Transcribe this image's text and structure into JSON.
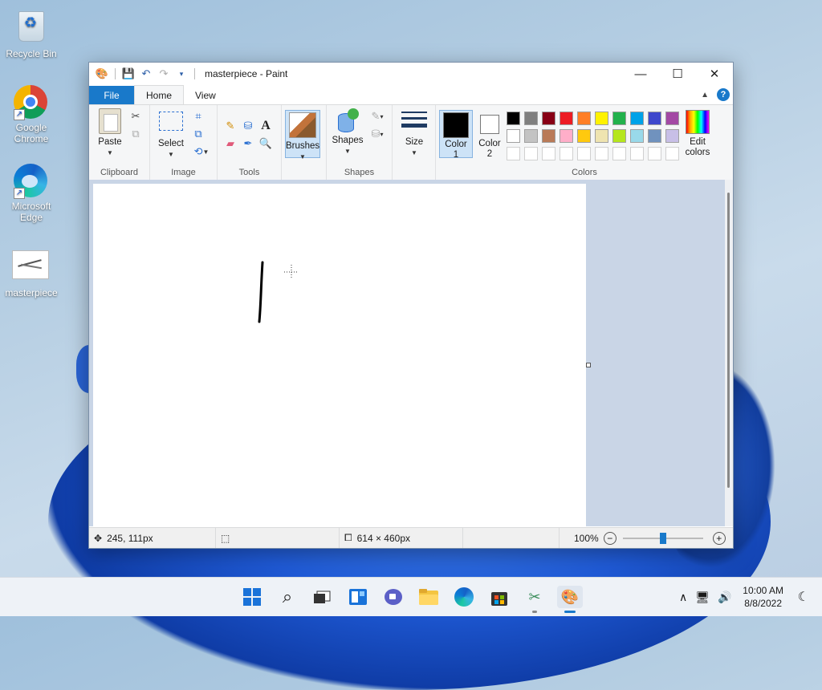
{
  "desktop": {
    "icons": [
      {
        "label": "Recycle Bin",
        "icon": "recycle-bin-icon"
      },
      {
        "label": "Google Chrome",
        "icon": "chrome-icon"
      },
      {
        "label": "Microsoft Edge",
        "icon": "edge-icon"
      },
      {
        "label": "masterpiece",
        "icon": "image-file-icon"
      }
    ]
  },
  "window": {
    "title": "masterpiece - Paint",
    "controls": {
      "minimize": "—",
      "maximize": "☐",
      "close": "✕"
    }
  },
  "tabs": {
    "file": "File",
    "home": "Home",
    "view": "View",
    "help": "?"
  },
  "ribbon": {
    "clipboard": {
      "paste": "Paste",
      "label": "Clipboard"
    },
    "image": {
      "select": "Select",
      "label": "Image"
    },
    "tools": {
      "label": "Tools",
      "text_glyph": "A"
    },
    "brushes": {
      "label": "Brushes"
    },
    "shapes": {
      "shapes": "Shapes",
      "label": "Shapes"
    },
    "size": {
      "label": "Size"
    },
    "colors": {
      "color1_line1": "Color",
      "color1_line2": "1",
      "color2_line1": "Color",
      "color2_line2": "2",
      "edit_line1": "Edit",
      "edit_line2": "colors",
      "label": "Colors",
      "color1": "#000000",
      "color2": "#ffffff",
      "row1": [
        "#000000",
        "#7f7f7f",
        "#880015",
        "#ed1c24",
        "#ff7f27",
        "#fff200",
        "#22b14c",
        "#00a2e8",
        "#3f48cc",
        "#a349a4"
      ],
      "row2": [
        "#ffffff",
        "#c3c3c3",
        "#b97a57",
        "#ffaec9",
        "#ffc90e",
        "#efe4b0",
        "#b5e61d",
        "#99d9ea",
        "#7092be",
        "#c8bfe7"
      ]
    }
  },
  "status": {
    "cursor_pos": "245, 111px",
    "image_size": "614 × 460px",
    "zoom": "100%",
    "zoom_fraction": 0.5
  },
  "taskbar": {
    "time": "10:00 AM",
    "date": "8/8/2022"
  }
}
